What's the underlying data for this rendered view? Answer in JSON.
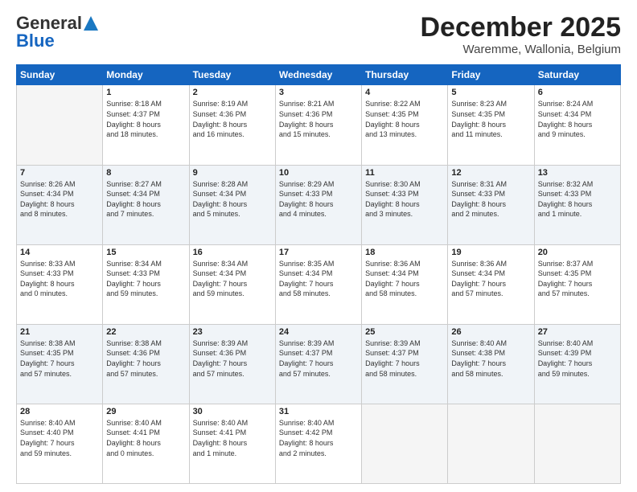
{
  "logo": {
    "general": "General",
    "blue": "Blue"
  },
  "title": "December 2025",
  "location": "Waremme, Wallonia, Belgium",
  "days_of_week": [
    "Sunday",
    "Monday",
    "Tuesday",
    "Wednesday",
    "Thursday",
    "Friday",
    "Saturday"
  ],
  "weeks": [
    [
      {
        "day": "",
        "info": ""
      },
      {
        "day": "1",
        "info": "Sunrise: 8:18 AM\nSunset: 4:37 PM\nDaylight: 8 hours\nand 18 minutes."
      },
      {
        "day": "2",
        "info": "Sunrise: 8:19 AM\nSunset: 4:36 PM\nDaylight: 8 hours\nand 16 minutes."
      },
      {
        "day": "3",
        "info": "Sunrise: 8:21 AM\nSunset: 4:36 PM\nDaylight: 8 hours\nand 15 minutes."
      },
      {
        "day": "4",
        "info": "Sunrise: 8:22 AM\nSunset: 4:35 PM\nDaylight: 8 hours\nand 13 minutes."
      },
      {
        "day": "5",
        "info": "Sunrise: 8:23 AM\nSunset: 4:35 PM\nDaylight: 8 hours\nand 11 minutes."
      },
      {
        "day": "6",
        "info": "Sunrise: 8:24 AM\nSunset: 4:34 PM\nDaylight: 8 hours\nand 9 minutes."
      }
    ],
    [
      {
        "day": "7",
        "info": "Sunrise: 8:26 AM\nSunset: 4:34 PM\nDaylight: 8 hours\nand 8 minutes."
      },
      {
        "day": "8",
        "info": "Sunrise: 8:27 AM\nSunset: 4:34 PM\nDaylight: 8 hours\nand 7 minutes."
      },
      {
        "day": "9",
        "info": "Sunrise: 8:28 AM\nSunset: 4:34 PM\nDaylight: 8 hours\nand 5 minutes."
      },
      {
        "day": "10",
        "info": "Sunrise: 8:29 AM\nSunset: 4:33 PM\nDaylight: 8 hours\nand 4 minutes."
      },
      {
        "day": "11",
        "info": "Sunrise: 8:30 AM\nSunset: 4:33 PM\nDaylight: 8 hours\nand 3 minutes."
      },
      {
        "day": "12",
        "info": "Sunrise: 8:31 AM\nSunset: 4:33 PM\nDaylight: 8 hours\nand 2 minutes."
      },
      {
        "day": "13",
        "info": "Sunrise: 8:32 AM\nSunset: 4:33 PM\nDaylight: 8 hours\nand 1 minute."
      }
    ],
    [
      {
        "day": "14",
        "info": "Sunrise: 8:33 AM\nSunset: 4:33 PM\nDaylight: 8 hours\nand 0 minutes."
      },
      {
        "day": "15",
        "info": "Sunrise: 8:34 AM\nSunset: 4:33 PM\nDaylight: 7 hours\nand 59 minutes."
      },
      {
        "day": "16",
        "info": "Sunrise: 8:34 AM\nSunset: 4:34 PM\nDaylight: 7 hours\nand 59 minutes."
      },
      {
        "day": "17",
        "info": "Sunrise: 8:35 AM\nSunset: 4:34 PM\nDaylight: 7 hours\nand 58 minutes."
      },
      {
        "day": "18",
        "info": "Sunrise: 8:36 AM\nSunset: 4:34 PM\nDaylight: 7 hours\nand 58 minutes."
      },
      {
        "day": "19",
        "info": "Sunrise: 8:36 AM\nSunset: 4:34 PM\nDaylight: 7 hours\nand 57 minutes."
      },
      {
        "day": "20",
        "info": "Sunrise: 8:37 AM\nSunset: 4:35 PM\nDaylight: 7 hours\nand 57 minutes."
      }
    ],
    [
      {
        "day": "21",
        "info": "Sunrise: 8:38 AM\nSunset: 4:35 PM\nDaylight: 7 hours\nand 57 minutes."
      },
      {
        "day": "22",
        "info": "Sunrise: 8:38 AM\nSunset: 4:36 PM\nDaylight: 7 hours\nand 57 minutes."
      },
      {
        "day": "23",
        "info": "Sunrise: 8:39 AM\nSunset: 4:36 PM\nDaylight: 7 hours\nand 57 minutes."
      },
      {
        "day": "24",
        "info": "Sunrise: 8:39 AM\nSunset: 4:37 PM\nDaylight: 7 hours\nand 57 minutes."
      },
      {
        "day": "25",
        "info": "Sunrise: 8:39 AM\nSunset: 4:37 PM\nDaylight: 7 hours\nand 58 minutes."
      },
      {
        "day": "26",
        "info": "Sunrise: 8:40 AM\nSunset: 4:38 PM\nDaylight: 7 hours\nand 58 minutes."
      },
      {
        "day": "27",
        "info": "Sunrise: 8:40 AM\nSunset: 4:39 PM\nDaylight: 7 hours\nand 59 minutes."
      }
    ],
    [
      {
        "day": "28",
        "info": "Sunrise: 8:40 AM\nSunset: 4:40 PM\nDaylight: 7 hours\nand 59 minutes."
      },
      {
        "day": "29",
        "info": "Sunrise: 8:40 AM\nSunset: 4:41 PM\nDaylight: 8 hours\nand 0 minutes."
      },
      {
        "day": "30",
        "info": "Sunrise: 8:40 AM\nSunset: 4:41 PM\nDaylight: 8 hours\nand 1 minute."
      },
      {
        "day": "31",
        "info": "Sunrise: 8:40 AM\nSunset: 4:42 PM\nDaylight: 8 hours\nand 2 minutes."
      },
      {
        "day": "",
        "info": ""
      },
      {
        "day": "",
        "info": ""
      },
      {
        "day": "",
        "info": ""
      }
    ]
  ]
}
